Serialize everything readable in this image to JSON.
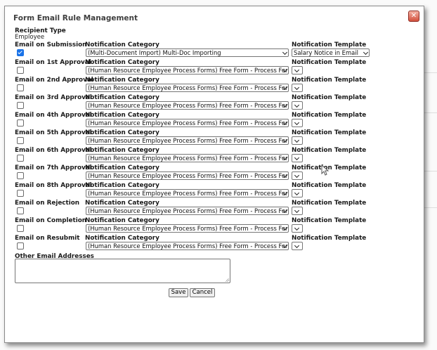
{
  "dialog": {
    "title": "Form Email Rule Management",
    "close_icon": "close-icon"
  },
  "recipient": {
    "label": "Recipient Type",
    "value": "Employee"
  },
  "category_label": "Notification Category",
  "template_label": "Notification Template",
  "rules": [
    {
      "label": "Email on Submission",
      "checked": true,
      "category": "(Multi-Document Import) Multi-Doc Importing",
      "template": "Salary Notice in Email"
    },
    {
      "label": "Email on 1st Approval",
      "checked": false,
      "category": "(Human Resource Employee Process Forms) Free Form - Process Forms",
      "template": ""
    },
    {
      "label": "Email on 2nd Approval",
      "checked": false,
      "category": "(Human Resource Employee Process Forms) Free Form - Process Forms",
      "template": ""
    },
    {
      "label": "Email on 3rd Approval",
      "checked": false,
      "category": "(Human Resource Employee Process Forms) Free Form - Process Forms",
      "template": ""
    },
    {
      "label": "Email on 4th Approval",
      "checked": false,
      "category": "(Human Resource Employee Process Forms) Free Form - Process Forms",
      "template": ""
    },
    {
      "label": "Email on 5th Approval",
      "checked": false,
      "category": "(Human Resource Employee Process Forms) Free Form - Process Forms",
      "template": ""
    },
    {
      "label": "Email on 6th Approval",
      "checked": false,
      "category": "(Human Resource Employee Process Forms) Free Form - Process Forms",
      "template": ""
    },
    {
      "label": "Email on 7th Approval",
      "checked": false,
      "category": "(Human Resource Employee Process Forms) Free Form - Process Forms",
      "template": ""
    },
    {
      "label": "Email on 8th Approval",
      "checked": false,
      "category": "(Human Resource Employee Process Forms) Free Form - Process Forms",
      "template": ""
    },
    {
      "label": "Email on Rejection",
      "checked": false,
      "category": "(Human Resource Employee Process Forms) Free Form - Process Forms",
      "template": ""
    },
    {
      "label": "Email on Completion",
      "checked": false,
      "category": "(Human Resource Employee Process Forms) Free Form - Process Forms",
      "template": ""
    },
    {
      "label": "Email on Resubmit",
      "checked": false,
      "category": "(Human Resource Employee Process Forms) Free Form - Process Forms",
      "template": ""
    }
  ],
  "other_emails": {
    "label": "Other Email Addresses",
    "value": ""
  },
  "buttons": {
    "save": "Save",
    "cancel": "Cancel"
  },
  "colors": {
    "checkbox_accent": "#1a73e8",
    "close_button": "#d2503c"
  }
}
